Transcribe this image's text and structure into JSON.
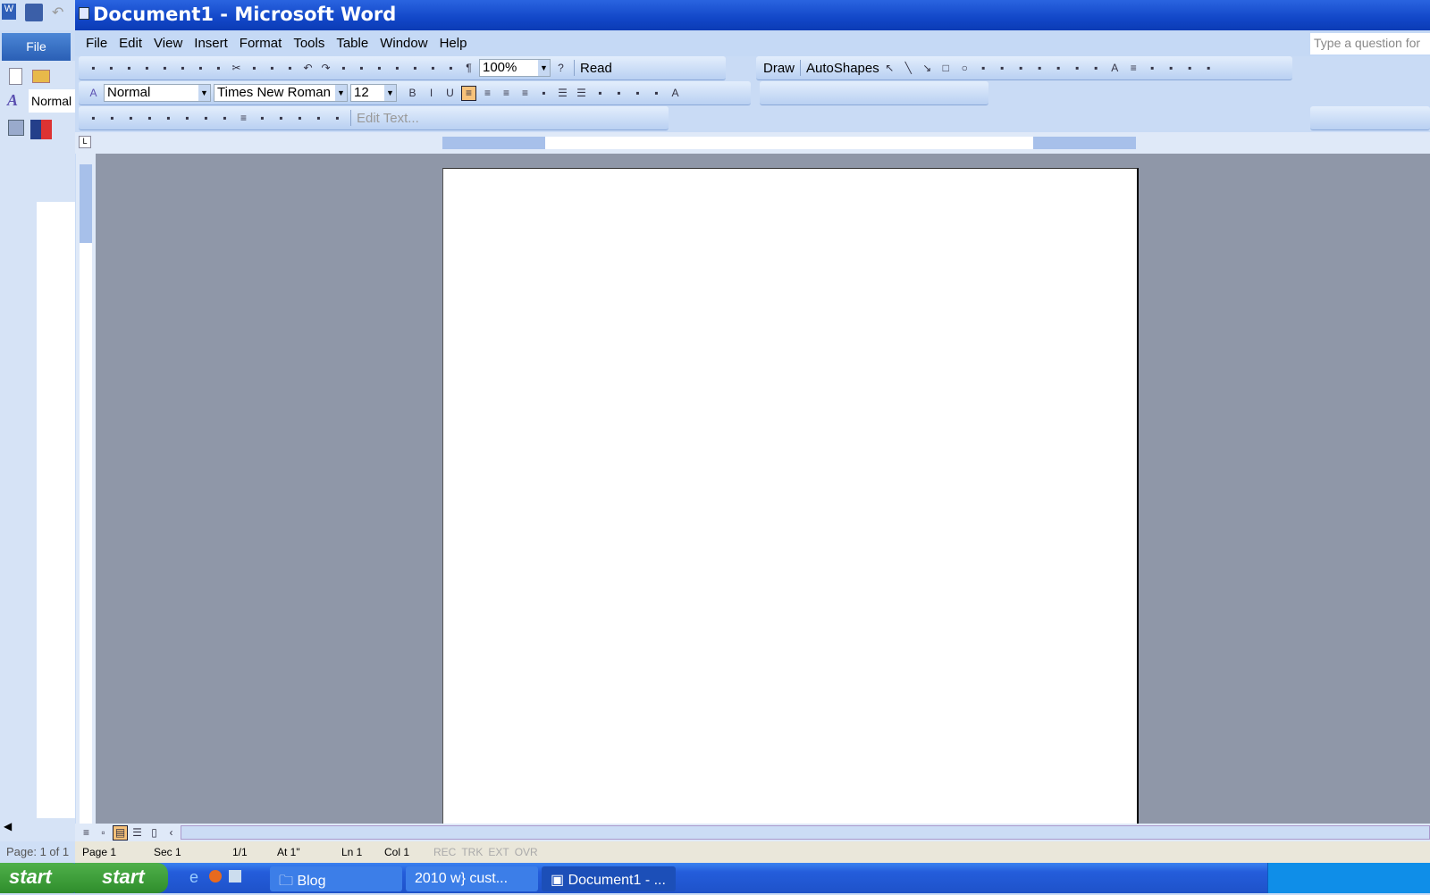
{
  "window": {
    "title": "Document1 - Microsoft Word"
  },
  "quick_access": {
    "file_tab": "File",
    "style_preview": "Normal"
  },
  "menu": [
    "File",
    "Edit",
    "View",
    "Insert",
    "Format",
    "Tools",
    "Table",
    "Window",
    "Help"
  ],
  "help_box": {
    "placeholder": "Type a question for"
  },
  "standard_toolbar": {
    "zoom": "100%",
    "read_label": "Read",
    "icons": [
      "new-icon",
      "open-icon",
      "save-icon",
      "permission-icon",
      "print-icon",
      "print-preview-icon",
      "spelling-icon",
      "research-icon",
      "cut-icon",
      "copy-icon",
      "paste-icon",
      "format-painter-icon",
      "undo-icon",
      "redo-icon",
      "hyperlink-icon",
      "tables-borders-icon",
      "insert-table-icon",
      "insert-excel-icon",
      "columns-icon",
      "drawing-icon",
      "document-map-icon",
      "show-formatting-icon"
    ]
  },
  "drawing_toolbar": {
    "draw_label": "Draw",
    "autoshapes_label": "AutoShapes",
    "icons": [
      "select-objects-icon",
      "line-icon",
      "arrow-icon",
      "rectangle-icon",
      "oval-icon",
      "text-box-icon",
      "wordart-icon",
      "diagram-icon",
      "clip-art-icon",
      "picture-icon",
      "fill-color-icon",
      "line-color-icon",
      "font-color-icon",
      "line-style-icon",
      "dash-style-icon",
      "arrow-style-icon",
      "shadow-icon",
      "3d-icon"
    ]
  },
  "formatting_toolbar": {
    "style": "Normal",
    "font": "Times New Roman",
    "size": "12",
    "icons": [
      "bold-icon",
      "italic-icon",
      "underline-icon",
      "align-left-icon",
      "center-icon",
      "align-right-icon",
      "justify-icon",
      "line-spacing-icon",
      "numbering-icon",
      "bullets-icon",
      "decrease-indent-icon",
      "increase-indent-icon",
      "borders-icon",
      "highlight-icon",
      "font-color-icon"
    ]
  },
  "picture_toolbar": {
    "edit_text_label": "Edit Text...",
    "icons": [
      "insert-picture-icon",
      "color-icon",
      "more-contrast-icon",
      "less-contrast-icon",
      "more-brightness-icon",
      "less-brightness-icon",
      "crop-icon",
      "rotate-icon",
      "line-style-icon",
      "compress-icon",
      "text-wrapping-icon",
      "format-picture-icon",
      "set-transparent-icon",
      "reset-picture-icon"
    ]
  },
  "status": {
    "left_pane": "Page: 1 of 1",
    "page": "Page 1",
    "sec": "Sec 1",
    "pages": "1/1",
    "at": "At 1\"",
    "ln": "Ln 1",
    "col": "Col 1",
    "rec": "REC",
    "trk": "TRK",
    "ext": "EXT",
    "ovr": "OVR"
  },
  "taskbar": {
    "start": "start",
    "tasks": [
      "Blog",
      "2010 w} cust...",
      "Document1 - ..."
    ]
  },
  "colors": {
    "titlebar": "#1247c8",
    "doc_background": "#8f97a8",
    "active_button": "#f7c27a"
  }
}
